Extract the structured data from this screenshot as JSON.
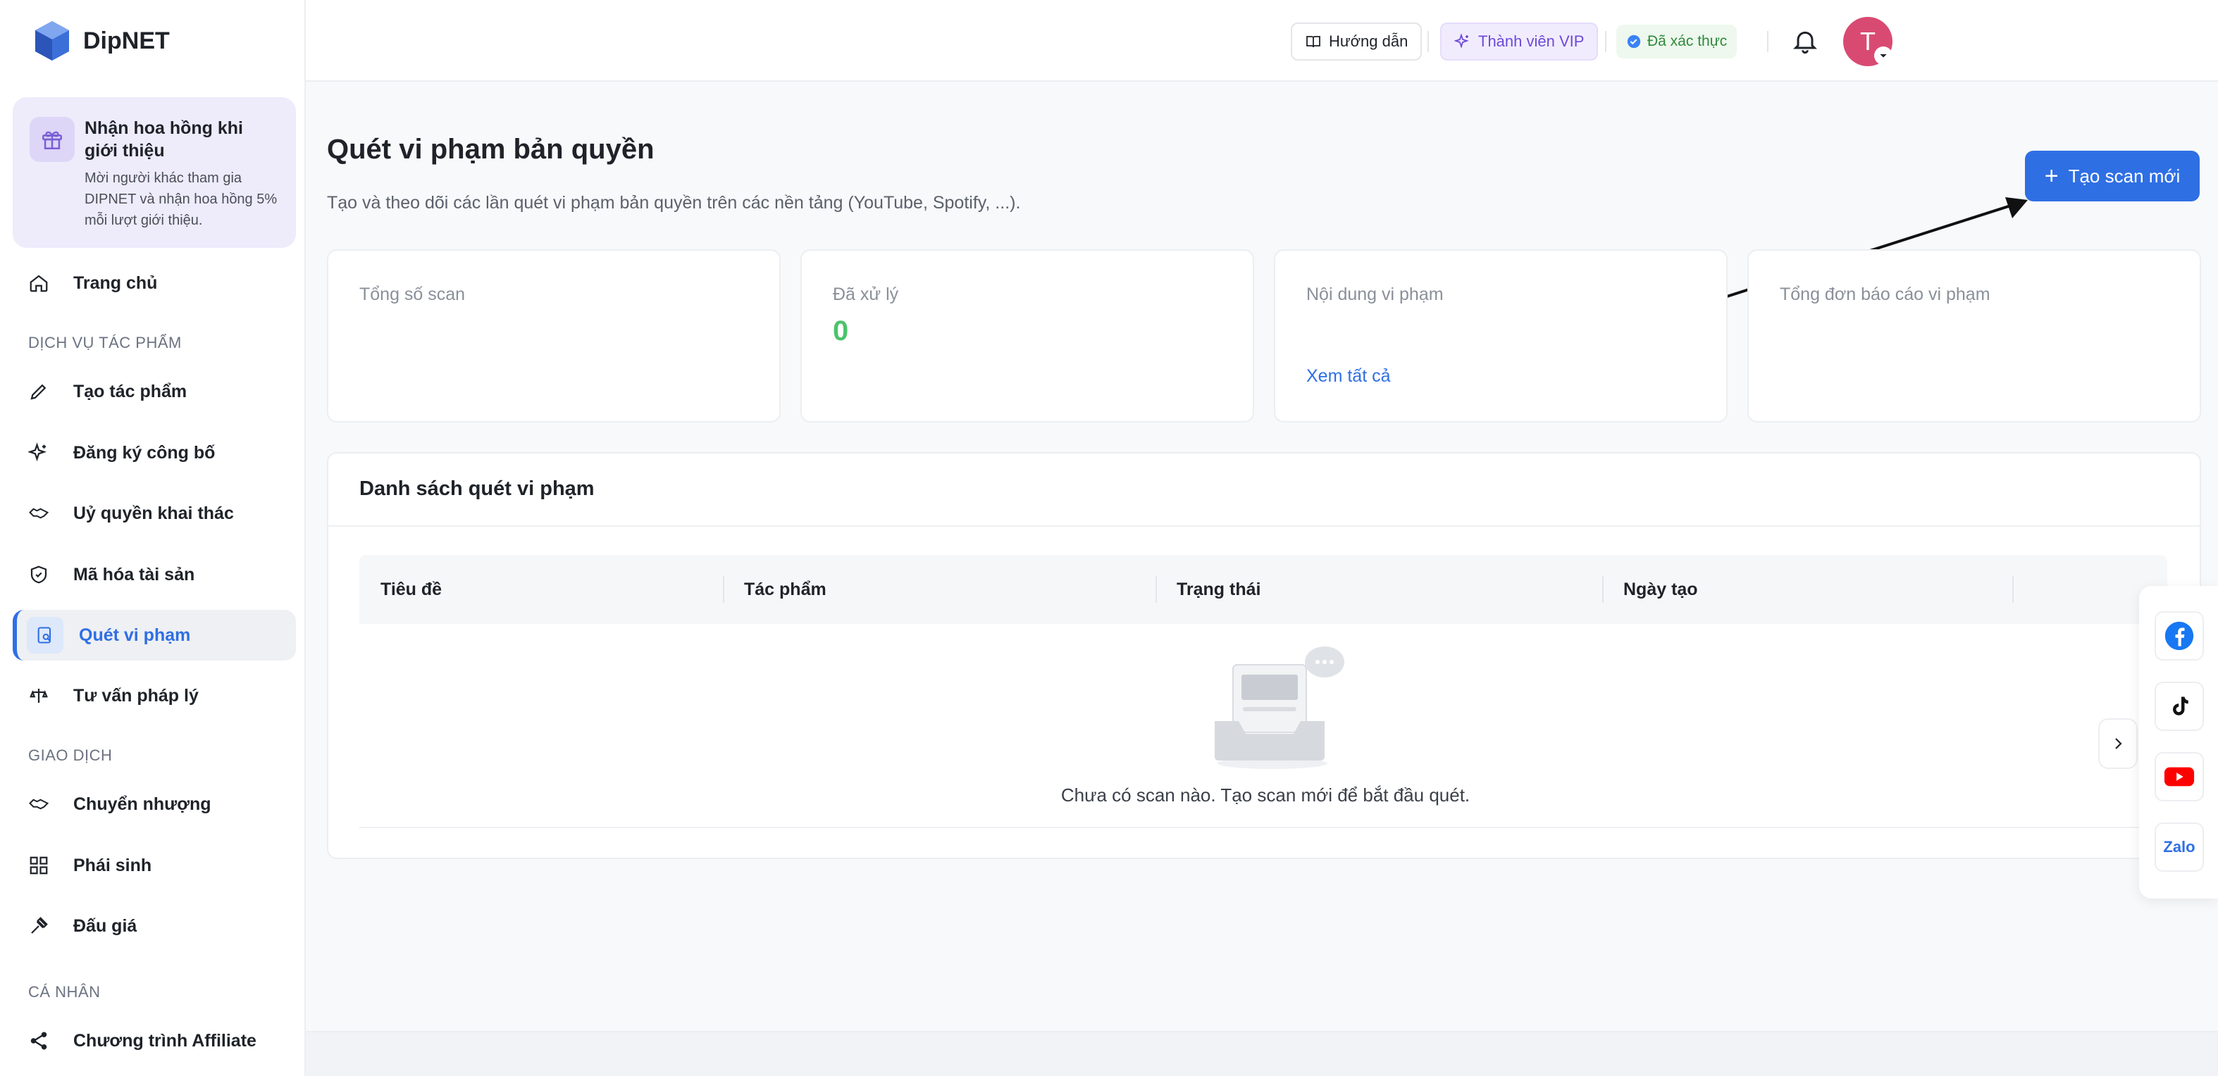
{
  "brand": {
    "name": "DipNET"
  },
  "promo": {
    "title": "Nhận hoa hồng khi giới thiệu",
    "desc": "Mời người khác tham gia DIPNET và nhận hoa hồng 5% mỗi lượt giới thiệu."
  },
  "sidebar": {
    "home": "Trang chủ",
    "sections": {
      "services": "DỊCH VỤ TÁC PHẨM",
      "trading": "GIAO DỊCH",
      "personal": "CÁ NHÂN"
    },
    "items": {
      "create": "Tạo tác phẩm",
      "register": "Đăng ký công bố",
      "license": "Uỷ quyền khai thác",
      "encrypt": "Mã hóa tài sản",
      "scan": "Quét vi phạm",
      "legal": "Tư vấn pháp lý",
      "transfer": "Chuyển nhượng",
      "derivative": "Phái sinh",
      "auction": "Đấu giá",
      "affiliate": "Chương trình Affiliate"
    }
  },
  "header": {
    "guide": "Hướng dẫn",
    "vip": "Thành viên VIP",
    "verified": "Đã xác thực",
    "avatar_initial": "T"
  },
  "page": {
    "title": "Quét vi phạm bản quyền",
    "desc": "Tạo và theo dõi các lần quét vi phạm bản quyền trên các nền tảng (YouTube, Spotify, ...).",
    "create_button": "Tạo scan mới"
  },
  "stats": {
    "total": {
      "label": "Tổng số scan"
    },
    "processed": {
      "label": "Đã xử lý",
      "value": "0"
    },
    "violations": {
      "label": "Nội dung vi phạm",
      "link": "Xem tất cả"
    },
    "reports": {
      "label": "Tổng đơn báo cáo vi phạm"
    }
  },
  "list": {
    "title": "Danh sách quét vi phạm",
    "columns": [
      "Tiêu đề",
      "Tác phẩm",
      "Trạng thái",
      "Ngày tạo"
    ],
    "empty": "Chưa có scan nào. Tạo scan mới để bắt đầu quét."
  },
  "social": {
    "zalo": "Zalo"
  },
  "colors": {
    "accent": "#2f6fe4",
    "success": "#4cc36b",
    "vip": "#6d4ad8",
    "avatar": "#d94a72"
  }
}
